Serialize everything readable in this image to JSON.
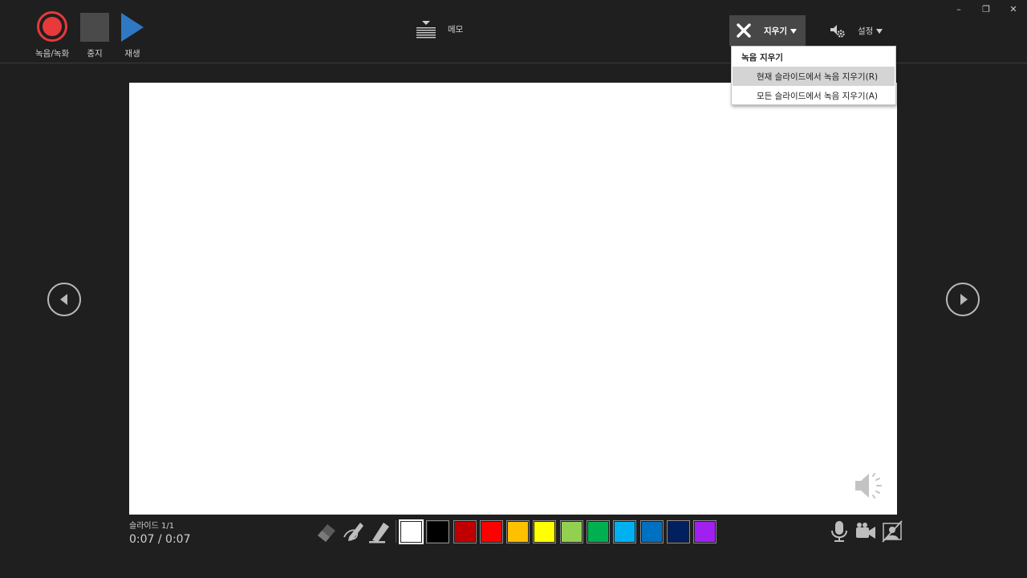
{
  "window": {
    "minimize": "–",
    "restore": "❐",
    "close": "✕"
  },
  "toolbar": {
    "record_label": "녹음/녹화",
    "stop_label": "중지",
    "play_label": "재생",
    "notes_label": "메모",
    "clear_label": "지우기",
    "settings_label": "설정"
  },
  "clear_menu": {
    "heading": "녹음 지우기",
    "items": [
      {
        "label": "현재 슬라이드에서 녹음 지우기(R)"
      },
      {
        "label": "모든 슬라이드에서 녹음 지우기(A)"
      }
    ]
  },
  "status": {
    "slide_info": "슬라이드 1/1",
    "time": "0:07  /  0:07"
  },
  "colors": {
    "record": "#e8393b",
    "play": "#2f78c4",
    "swatches": [
      "#ffffff",
      "#000000",
      "#c00000",
      "#ff0000",
      "#ffc000",
      "#ffff00",
      "#92d050",
      "#00b050",
      "#00b0f0",
      "#0070c0",
      "#002060",
      "#a020f0"
    ]
  },
  "icons": {
    "record": "record-icon",
    "stop": "stop-icon",
    "play": "play-icon",
    "notes": "notes-icon",
    "clear": "close-x-icon",
    "settings": "settings-gear-icon",
    "speaker": "speaker-icon",
    "eraser": "eraser-icon",
    "pen": "pen-icon",
    "highlighter": "highlighter-icon",
    "microphone": "microphone-icon",
    "camera": "camera-icon",
    "camera_preview": "camera-preview-off-icon"
  }
}
